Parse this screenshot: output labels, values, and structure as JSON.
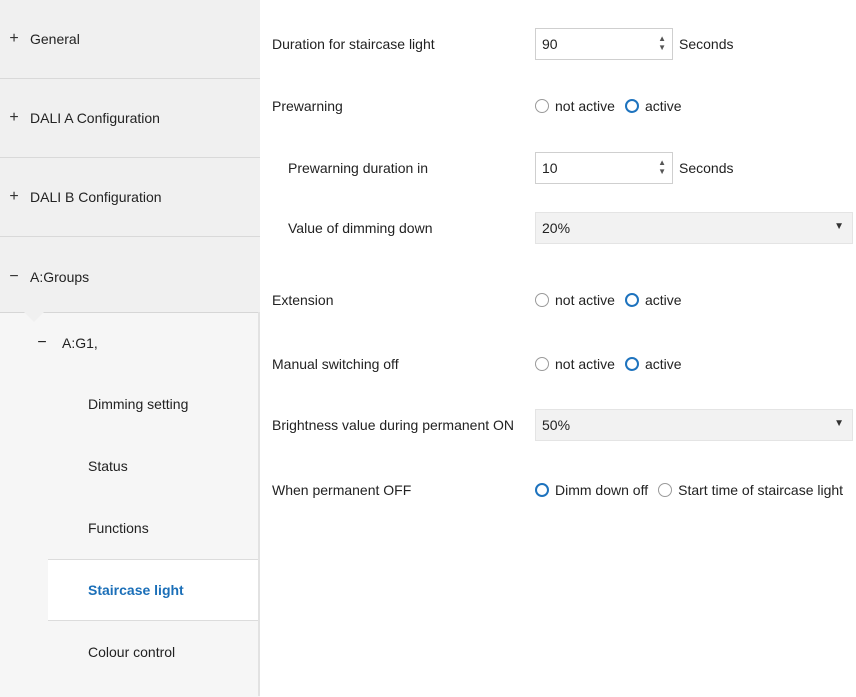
{
  "sidebar": {
    "top_items": [
      {
        "sign": "+",
        "label": "General"
      },
      {
        "sign": "+",
        "label": "DALI A Configuration"
      },
      {
        "sign": "+",
        "label": "DALI B Configuration"
      },
      {
        "sign": "−",
        "label": "A:Groups"
      }
    ],
    "sub_group": {
      "sign": "−",
      "label": "A:G1,"
    },
    "leaves": [
      {
        "label": "Dimming setting"
      },
      {
        "label": "Status"
      },
      {
        "label": "Functions"
      },
      {
        "label": "Staircase light"
      },
      {
        "label": "Colour control"
      }
    ],
    "active_leaf": "Staircase light"
  },
  "settings": {
    "duration": {
      "label": "Duration for staircase light",
      "value": "90",
      "unit": "Seconds"
    },
    "prewarning": {
      "label": "Prewarning",
      "options": [
        "not active",
        "active"
      ],
      "selected": "active"
    },
    "prewarning_duration": {
      "label": "Prewarning duration in",
      "value": "10",
      "unit": "Seconds"
    },
    "dimming_down": {
      "label": "Value of dimming down",
      "value": "20%"
    },
    "extension": {
      "label": "Extension",
      "options": [
        "not active",
        "active"
      ],
      "selected": "active"
    },
    "manual_off": {
      "label": "Manual switching off",
      "options": [
        "not active",
        "active"
      ],
      "selected": "active"
    },
    "brightness": {
      "label": "Brightness value during permanent ON",
      "value": "50%"
    },
    "permanent_off": {
      "label": "When permanent OFF",
      "options": [
        "Dimm down off",
        "Start time of staircase light"
      ],
      "selected": "Dimm down off"
    }
  },
  "icons": {
    "spin_up": "▲",
    "spin_down": "▼",
    "caret": "▼"
  },
  "colors": {
    "accent": "#1e73be",
    "active_text": "#1b6fb8"
  }
}
